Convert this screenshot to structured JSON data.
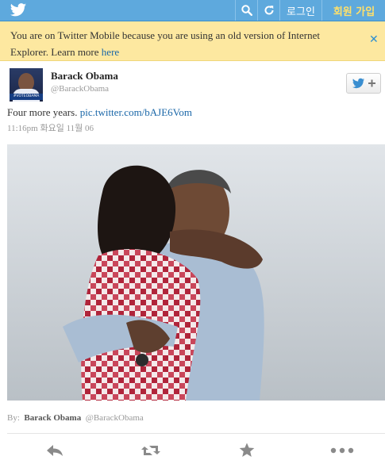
{
  "topbar": {
    "logo": "twitter-bird-icon",
    "login_label": "로그인",
    "signup_label": "회원 가입",
    "accent": "#5ea9dd",
    "signup_color": "#ffe06a"
  },
  "notice": {
    "text": "You are on Twitter Mobile because you are using an old version of Internet Explorer. Learn more",
    "link_text": "here",
    "close_icon": "close-icon",
    "background": "#fde8a0"
  },
  "tweet": {
    "author_name": "Barack Obama",
    "author_handle": "@BarackObama",
    "avatar_badge": "#VOTEOBAMA",
    "follow_icon": "follow-plus-icon",
    "text": "Four more years.",
    "link_text": "pic.twitter.com/bAJE6Vom",
    "timestamp": "11:16pm 화요일 11월 06"
  },
  "byline": {
    "prefix": "By:",
    "name": "Barack Obama",
    "handle": "@BarackObama"
  },
  "actions": [
    "reply-icon",
    "retweet-icon",
    "favorite-icon",
    "more-icon"
  ]
}
